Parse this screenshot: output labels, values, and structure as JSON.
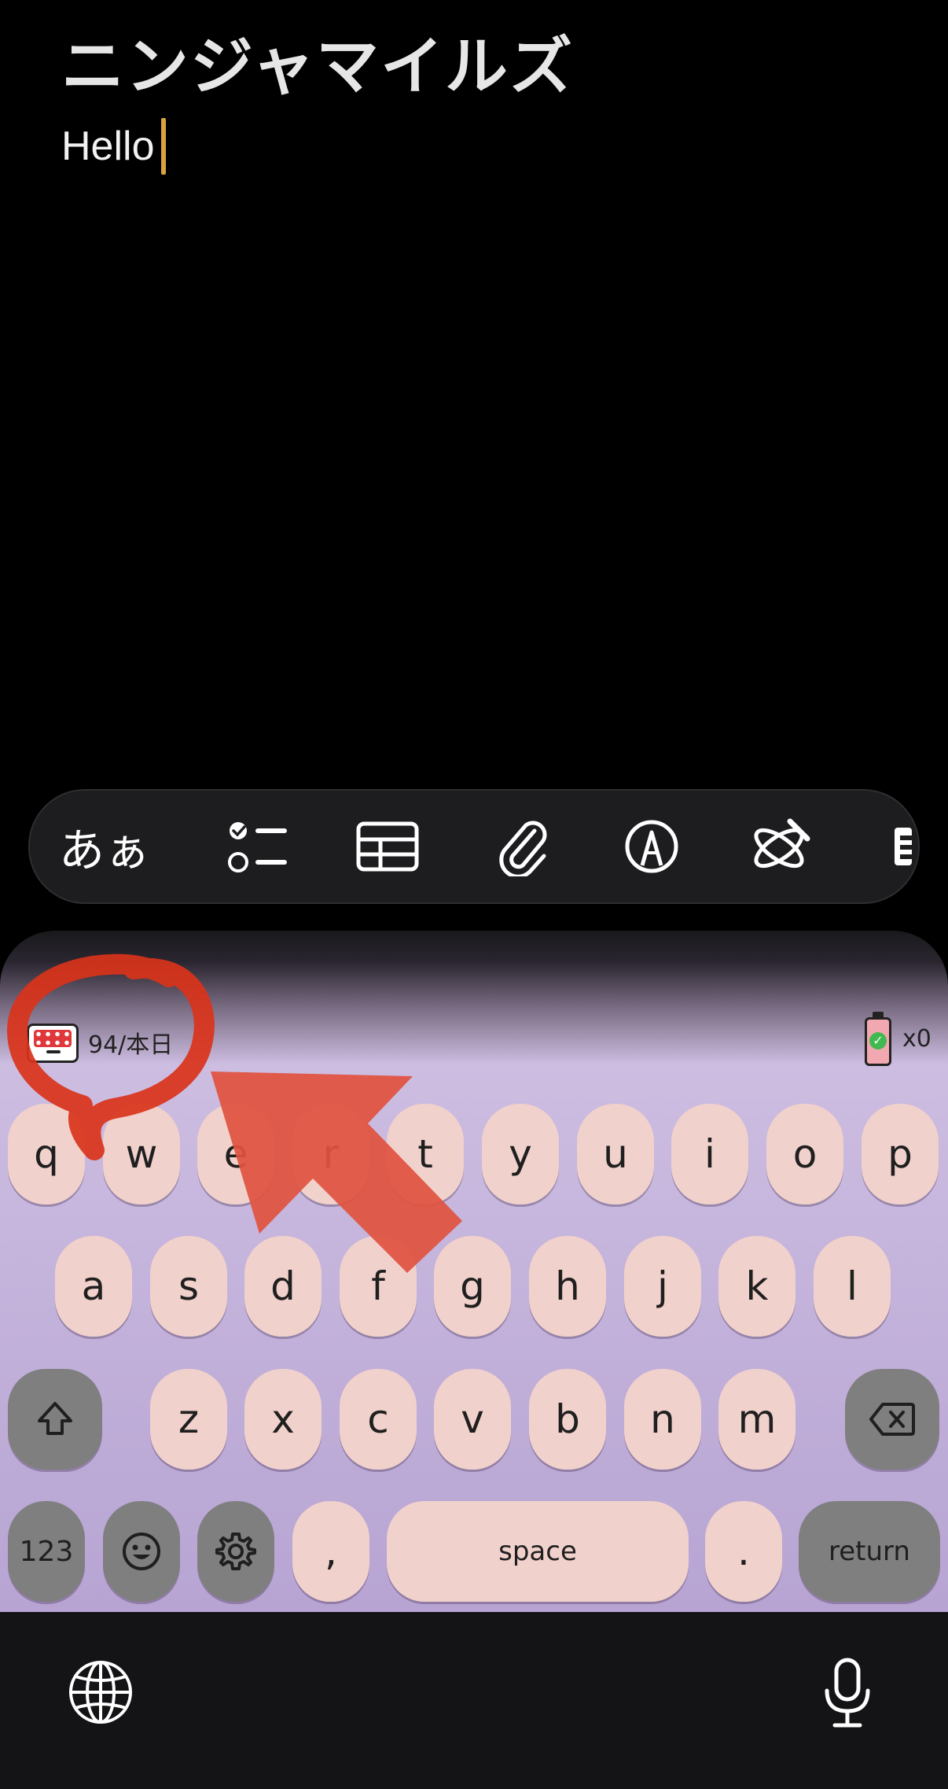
{
  "note": {
    "title": "ニンジャマイルズ",
    "body": "Hello"
  },
  "format_bar": {
    "text_style_label": "あぁ",
    "items": [
      "text-style",
      "checklist",
      "table",
      "attachment",
      "markup",
      "apple-intelligence",
      "more"
    ]
  },
  "keyboard": {
    "status": {
      "count_label": "94/本日",
      "battery_label": "x0"
    },
    "row1": [
      "q",
      "w",
      "e",
      "r",
      "t",
      "y",
      "u",
      "i",
      "o",
      "p"
    ],
    "row2": [
      "a",
      "s",
      "d",
      "f",
      "g",
      "h",
      "j",
      "k",
      "l"
    ],
    "row3": [
      "z",
      "x",
      "c",
      "v",
      "b",
      "n",
      "m"
    ],
    "row4": {
      "numbers": "123",
      "comma": ",",
      "space": "space",
      "period": ".",
      "return": "return"
    },
    "colors": {
      "key": "#f1d1cb",
      "function_key": "#7f7f7f",
      "background": "#c2b1da"
    }
  },
  "annotation": {
    "color": "#d9331a"
  }
}
